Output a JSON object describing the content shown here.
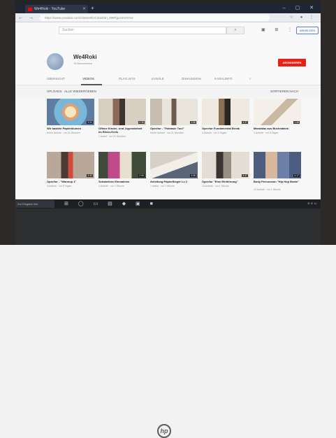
{
  "browser": {
    "tab_title": "We4Roki - YouTube",
    "url": "https://www.youtube.com/channel/UC3c8Z3n_4t9FfguzmVmVw",
    "newtab_glyph": "+",
    "window_controls": "– ▢ ✕"
  },
  "youtube": {
    "search_placeholder": "Suchen",
    "signin_label": "ANMELDEN",
    "icons": [
      "video-camera-icon",
      "apps-icon",
      "more-icon",
      "account-icon"
    ]
  },
  "channel": {
    "name": "We4Roki",
    "subscribers": "75 Abonnenten",
    "subscribe_label": "ABONNIEREN",
    "tabs": [
      "ÜBERSICHT",
      "VIDEOS",
      "PLAYLISTS",
      "KANÄLE",
      "DISKUSSION",
      "KANALINFO"
    ],
    "active_tab": "VIDEOS"
  },
  "filter": {
    "uploads_label": "UPLOADS",
    "play_all_label": "ALLE WIEDERGEBEN",
    "sort_label": "SORTIEREN NACH"
  },
  "videos": [
    {
      "title": "Wir basteln Papierblumen",
      "meta": "Keine Aufrufe · vor 21 Stunden",
      "duration": "3:11"
    },
    {
      "title": "Offene Kinder- und Jugendarbeit im Rhein-Kreis",
      "meta": "1 Aufruf · vor 21 Stunden",
      "duration": "0:38"
    },
    {
      "title": "Oper/tor - \"Fantasie Tool\"",
      "meta": "Keine Aufrufe · vor 21 Stunden",
      "duration": "3:56"
    },
    {
      "title": "Oper/tor Fundamental Break",
      "meta": "4 Aufrufe · vor 3 Tagen",
      "duration": "4:37"
    },
    {
      "title": "Mandalas aus Buchstaben",
      "meta": "2 Aufrufe · vor 5 Tagen",
      "duration": "1:36"
    },
    {
      "title": "Oper/tor - \"Warmup 1\"",
      "meta": "3 Aufrufe · vor 5 Tagen",
      "duration": "3:42"
    },
    {
      "title": "Schabekies Einmaleins",
      "meta": "4 Aufrufe · vor 1 Woche",
      "duration": "2:05"
    },
    {
      "title": "Anleitung Papierflieger Lv 2",
      "meta": "1 Aufruf · vor 1 Woche",
      "duration": "4:35"
    },
    {
      "title": "Oper/tor \"Eine Einführung\"",
      "meta": "13 Aufrufe · vor 1 Woche",
      "duration": "3:47"
    },
    {
      "title": "Body Percussion \"Hip Hop Beats\"",
      "meta": "12 Aufrufe · vor 1 Woche",
      "duration": "2:17"
    }
  ],
  "taskbar": {
    "search_text": "Zur Eingabe hier",
    "tray_text": "DEU",
    "icons": [
      "windows-icon",
      "search-icon",
      "task-view-icon",
      "file-explorer-icon",
      "edge-icon",
      "store-icon",
      "word-icon",
      "chrome-icon"
    ]
  },
  "colors": {
    "accent_red": "#e62117",
    "signin_blue": "#3b67c2"
  }
}
